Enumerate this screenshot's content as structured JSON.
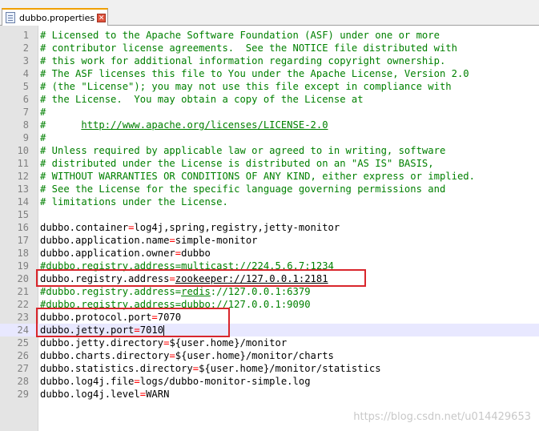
{
  "tab": {
    "filename": "dubbo.properties",
    "close_glyph": "✕"
  },
  "lines": [
    {
      "n": "1",
      "type": "comment",
      "text": "# Licensed to the Apache Software Foundation (ASF) under one or more"
    },
    {
      "n": "2",
      "type": "comment",
      "text": "# contributor license agreements.  See the NOTICE file distributed with"
    },
    {
      "n": "3",
      "type": "comment",
      "text": "# this work for additional information regarding copyright ownership."
    },
    {
      "n": "4",
      "type": "comment",
      "text": "# The ASF licenses this file to You under the Apache License, Version 2.0"
    },
    {
      "n": "5",
      "type": "comment",
      "text": "# (the \"License\"); you may not use this file except in compliance with"
    },
    {
      "n": "6",
      "type": "comment",
      "text": "# the License.  You may obtain a copy of the License at"
    },
    {
      "n": "7",
      "type": "comment",
      "text": "#"
    },
    {
      "n": "8",
      "type": "comment_link",
      "prefix": "#      ",
      "link": "http://www.apache.org/licenses/LICENSE-2.0"
    },
    {
      "n": "9",
      "type": "comment",
      "text": "#"
    },
    {
      "n": "10",
      "type": "comment",
      "text": "# Unless required by applicable law or agreed to in writing, software"
    },
    {
      "n": "11",
      "type": "comment",
      "text": "# distributed under the License is distributed on an \"AS IS\" BASIS,"
    },
    {
      "n": "12",
      "type": "comment",
      "text": "# WITHOUT WARRANTIES OR CONDITIONS OF ANY KIND, either express or implied."
    },
    {
      "n": "13",
      "type": "comment",
      "text": "# See the License for the specific language governing permissions and"
    },
    {
      "n": "14",
      "type": "comment",
      "text": "# limitations under the License."
    },
    {
      "n": "15",
      "type": "blank",
      "text": ""
    },
    {
      "n": "16",
      "type": "prop",
      "key": "dubbo.container",
      "value": "log4j,spring,registry,jetty-monitor"
    },
    {
      "n": "17",
      "type": "prop",
      "key": "dubbo.application.name",
      "value": "simple-monitor"
    },
    {
      "n": "18",
      "type": "prop",
      "key": "dubbo.application.owner",
      "value": "dubbo"
    },
    {
      "n": "19",
      "type": "cprop",
      "key": "#dubbo.registry.address",
      "scheme": "multicast",
      "rest": "://224.5.6.7:1234"
    },
    {
      "n": "20",
      "type": "uprop",
      "key": "dubbo.registry.address",
      "scheme": "zookeeper",
      "rest": "://127.0.0.1:2181"
    },
    {
      "n": "21",
      "type": "cprop",
      "key": "#dubbo.registry.address",
      "scheme": "redis",
      "rest": "://127.0.0.1:6379"
    },
    {
      "n": "22",
      "type": "cprop",
      "key": "#dubbo.registry.address",
      "scheme": "dubbo",
      "rest": "://127.0.0.1:9090"
    },
    {
      "n": "23",
      "type": "prop",
      "key": "dubbo.protocol.port",
      "value": "7070"
    },
    {
      "n": "24",
      "type": "prop",
      "key": "dubbo.jetty.port",
      "value": "7010",
      "current": true
    },
    {
      "n": "25",
      "type": "prop",
      "key": "dubbo.jetty.directory",
      "value": "${user.home}/monitor"
    },
    {
      "n": "26",
      "type": "prop",
      "key": "dubbo.charts.directory",
      "value": "${user.home}/monitor/charts"
    },
    {
      "n": "27",
      "type": "prop",
      "key": "dubbo.statistics.directory",
      "value": "${user.home}/monitor/statistics"
    },
    {
      "n": "28",
      "type": "prop",
      "key": "dubbo.log4j.file",
      "value": "logs/dubbo-monitor-simple.log"
    },
    {
      "n": "29",
      "type": "prop",
      "key": "dubbo.log4j.level",
      "value": "WARN"
    }
  ],
  "watermark": "https://blog.csdn.net/u014429653",
  "colors": {
    "comment": "#008000",
    "equals": "#ff0000",
    "highlight_box": "#d9262c",
    "current_line": "#e8e8ff"
  }
}
